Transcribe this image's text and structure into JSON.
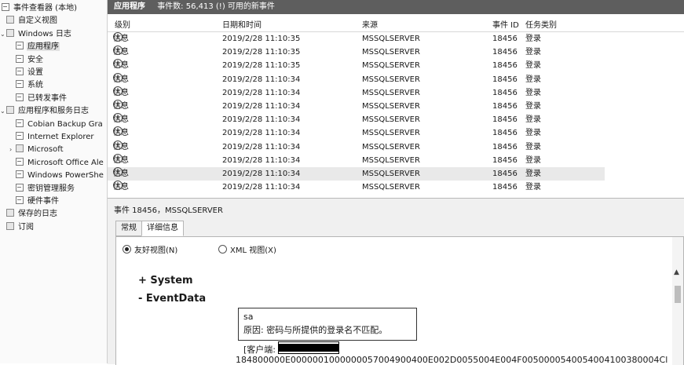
{
  "sidebar": {
    "items": [
      {
        "label": "事件查看器 (本地)",
        "icon": "event-viewer-icon"
      },
      {
        "label": "自定义视图",
        "icon": "folder-icon"
      },
      {
        "label": "Windows 日志",
        "icon": "folder-icon"
      },
      {
        "label": "应用程序",
        "icon": "log-icon"
      },
      {
        "label": "安全",
        "icon": "log-icon"
      },
      {
        "label": "设置",
        "icon": "log-icon"
      },
      {
        "label": "系统",
        "icon": "log-icon"
      },
      {
        "label": "已转发事件",
        "icon": "log-icon"
      },
      {
        "label": "应用程序和服务日志",
        "icon": "folder-icon"
      },
      {
        "label": "Cobian Backup Gra",
        "icon": "log-icon"
      },
      {
        "label": "Internet Explorer",
        "icon": "log-icon"
      },
      {
        "label": "Microsoft",
        "icon": "folder-icon"
      },
      {
        "label": "Microsoft Office Ale",
        "icon": "log-icon"
      },
      {
        "label": "Windows PowerShe",
        "icon": "log-icon"
      },
      {
        "label": "密钥管理服务",
        "icon": "log-icon"
      },
      {
        "label": "硬件事件",
        "icon": "log-icon"
      },
      {
        "label": "保存的日志",
        "icon": "folder-icon"
      },
      {
        "label": "订阅",
        "icon": "folder-icon"
      }
    ],
    "selected_index": 3
  },
  "header": {
    "title": "应用程序",
    "count_text": "事件数: 56,413 (!) 可用的新事件"
  },
  "grid": {
    "columns": [
      "级别",
      "日期和时间",
      "来源",
      "事件 ID",
      "任务类别"
    ],
    "rows": [
      {
        "level": "信息",
        "datetime": "2019/2/28 11:10:35",
        "source": "MSSQLSERVER",
        "event_id": "18456",
        "category": "登录"
      },
      {
        "level": "信息",
        "datetime": "2019/2/28 11:10:35",
        "source": "MSSQLSERVER",
        "event_id": "18456",
        "category": "登录"
      },
      {
        "level": "信息",
        "datetime": "2019/2/28 11:10:35",
        "source": "MSSQLSERVER",
        "event_id": "18456",
        "category": "登录"
      },
      {
        "level": "信息",
        "datetime": "2019/2/28 11:10:34",
        "source": "MSSQLSERVER",
        "event_id": "18456",
        "category": "登录"
      },
      {
        "level": "信息",
        "datetime": "2019/2/28 11:10:34",
        "source": "MSSQLSERVER",
        "event_id": "18456",
        "category": "登录"
      },
      {
        "level": "信息",
        "datetime": "2019/2/28 11:10:34",
        "source": "MSSQLSERVER",
        "event_id": "18456",
        "category": "登录"
      },
      {
        "level": "信息",
        "datetime": "2019/2/28 11:10:34",
        "source": "MSSQLSERVER",
        "event_id": "18456",
        "category": "登录"
      },
      {
        "level": "信息",
        "datetime": "2019/2/28 11:10:34",
        "source": "MSSQLSERVER",
        "event_id": "18456",
        "category": "登录"
      },
      {
        "level": "信息",
        "datetime": "2019/2/28 11:10:34",
        "source": "MSSQLSERVER",
        "event_id": "18456",
        "category": "登录"
      },
      {
        "level": "信息",
        "datetime": "2019/2/28 11:10:34",
        "source": "MSSQLSERVER",
        "event_id": "18456",
        "category": "登录"
      },
      {
        "level": "信息",
        "datetime": "2019/2/28 11:10:34",
        "source": "MSSQLSERVER",
        "event_id": "18456",
        "category": "登录"
      },
      {
        "level": "信息",
        "datetime": "2019/2/28 11:10:34",
        "source": "MSSQLSERVER",
        "event_id": "18456",
        "category": "登录"
      }
    ],
    "highlighted_row": 11
  },
  "detail": {
    "title": "事件 18456，MSSQLSERVER",
    "tabs": [
      "常规",
      "详细信息"
    ],
    "active_tab": 1,
    "view_options": {
      "friendly": "友好视图(N)",
      "xml": "XML 视图(X)",
      "selected": "friendly"
    },
    "sections": [
      "+ System",
      "- EventData"
    ],
    "event_data": {
      "user": "sa",
      "reason": "原因: 密码与所提供的登录名不匹配。",
      "client_prefix": "[客户端:",
      "binary": "184800000E0000001000000057004900400E002D0055004E004F0050000540054004100380004Cl"
    }
  }
}
